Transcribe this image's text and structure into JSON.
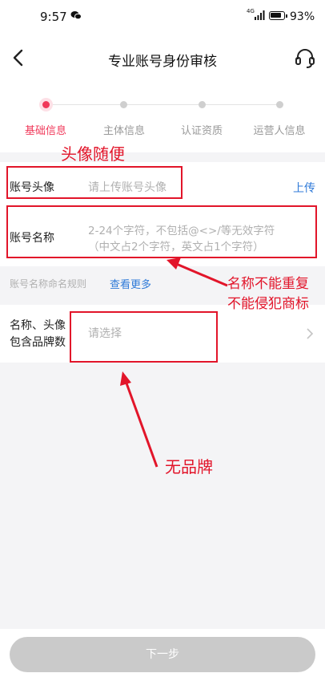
{
  "status_bar": {
    "time": "9:57",
    "network": "4G",
    "battery": "93%"
  },
  "header": {
    "title": "专业账号身份审核",
    "back_icon": "chevron-left-icon",
    "service_icon": "headset-icon"
  },
  "steps": [
    {
      "label": "基础信息",
      "active": true
    },
    {
      "label": "主体信息",
      "active": false
    },
    {
      "label": "认证资质",
      "active": false
    },
    {
      "label": "运营人信息",
      "active": false
    }
  ],
  "form": {
    "avatar": {
      "label": "账号头像",
      "placeholder": "请上传账号头像",
      "action": "上传"
    },
    "name": {
      "label": "账号名称",
      "placeholder_line1": "2-24个字符，不包括@<>/等无效字符",
      "placeholder_line2": "（中文占2个字符，英文占1个字符）"
    },
    "rules": {
      "text": "账号名称命名规则",
      "link": "查看更多"
    },
    "brand": {
      "label_line1": "名称、头像",
      "label_line2": "包含品牌数",
      "placeholder": "请选择"
    }
  },
  "annotations": {
    "avatar_note": "头像随便",
    "name_note_line1": "名称不能重复",
    "name_note_line2": "不能侵犯商标",
    "brand_note": "无品牌",
    "color": "#e2152a"
  },
  "footer": {
    "next_label": "下一步"
  },
  "colors": {
    "accent": "#f0395a",
    "link": "#2f7ad8",
    "disabled_button": "#cacaca"
  }
}
